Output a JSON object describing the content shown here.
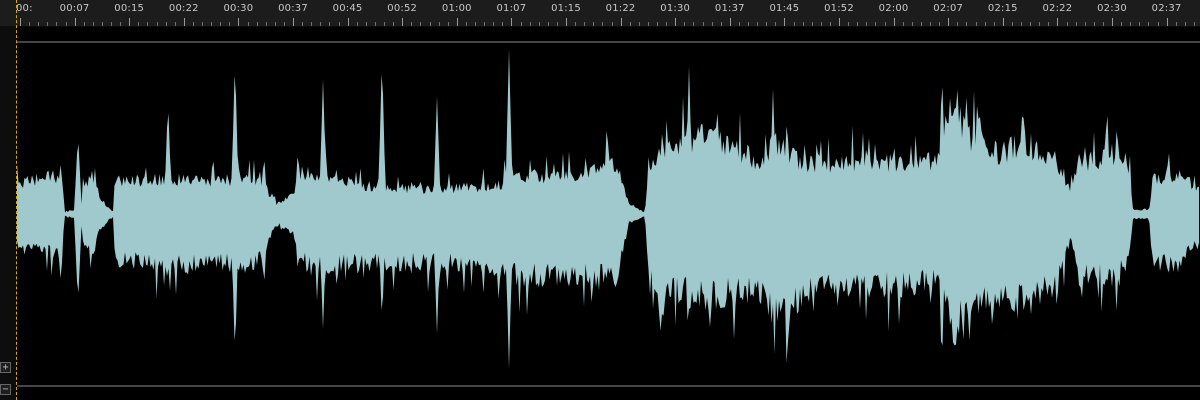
{
  "timeline": {
    "labels": [
      "00:",
      "00:07",
      "00:15",
      "00:22",
      "00:30",
      "00:37",
      "00:45",
      "00:52",
      "01:00",
      "01:07",
      "01:15",
      "01:22",
      "01:30",
      "01:37",
      "01:45",
      "01:52",
      "02:00",
      "02:07",
      "02:15",
      "02:22",
      "02:30",
      "02:37"
    ]
  },
  "waveform": {
    "color": "#9fc9cc",
    "background": "#000000",
    "guide_color": "#8a8a8a"
  },
  "playhead": {
    "color": "#d9a800"
  },
  "zoom": {
    "in_icon": "plus-icon",
    "in_glyph": "+",
    "out_icon": "minus-icon",
    "out_glyph": "−"
  }
}
